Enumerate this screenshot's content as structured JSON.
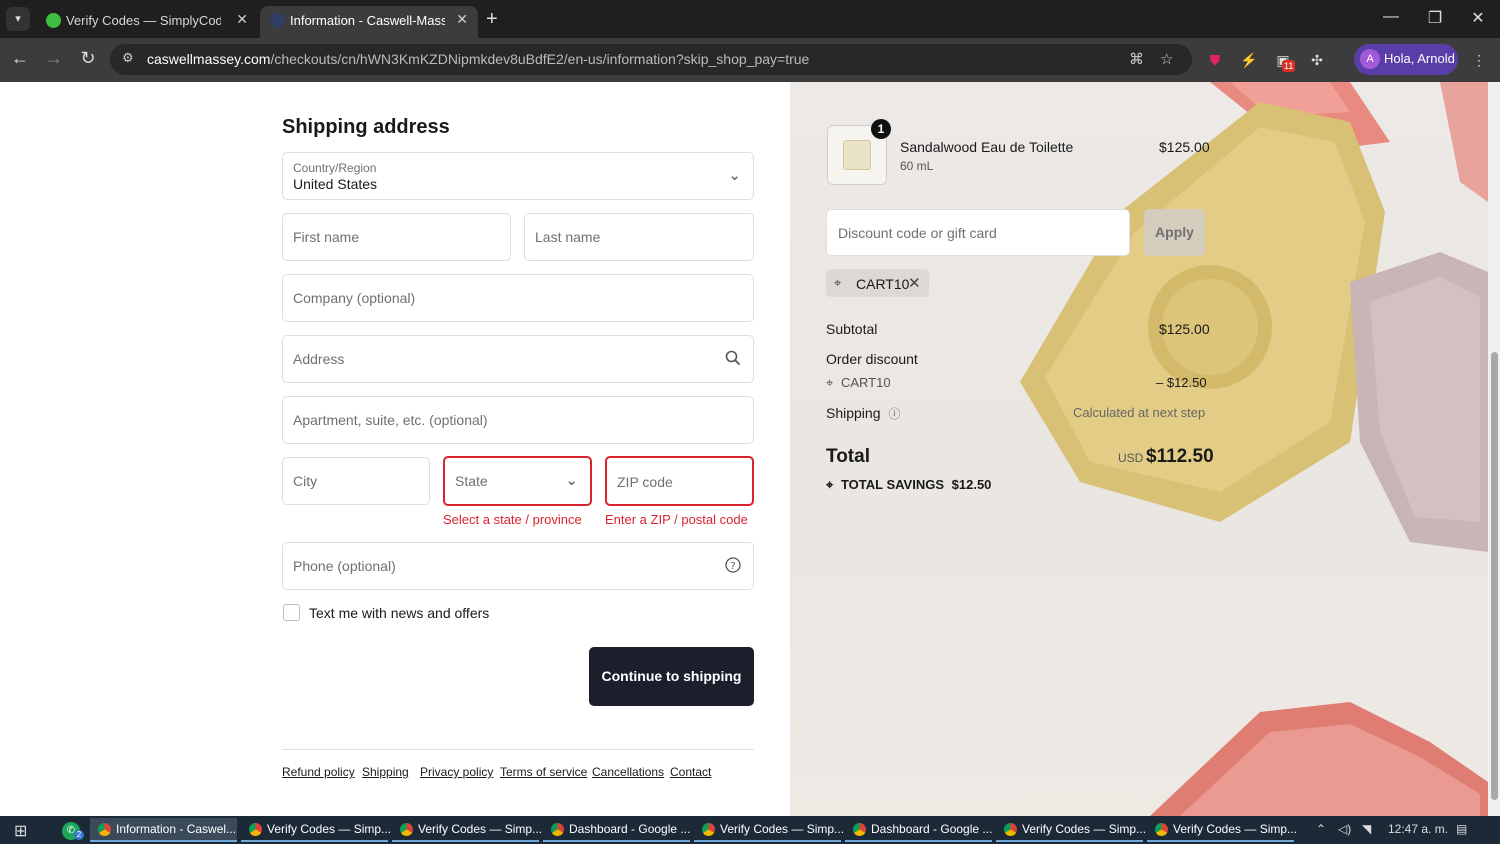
{
  "browser": {
    "tabs": [
      {
        "title": "Verify Codes — SimplyCodes",
        "active": false
      },
      {
        "title": "Information - Caswell-Massey®",
        "active": true
      }
    ],
    "url_domain": "caswellmassey.com",
    "url_path": "/checkouts/cn/hWN3KmKZDNipmkdev8uBdfE2/en-us/information?skip_shop_pay=true",
    "profile_name": "Hola, Arnold",
    "profile_initial": "A",
    "extension_badge": "11"
  },
  "form": {
    "section_title": "Shipping address",
    "country_label": "Country/Region",
    "country_value": "United States",
    "first_name_placeholder": "First name",
    "last_name_placeholder": "Last name",
    "company_placeholder": "Company (optional)",
    "address_placeholder": "Address",
    "apartment_placeholder": "Apartment, suite, etc. (optional)",
    "city_placeholder": "City",
    "state_placeholder": "State",
    "zip_placeholder": "ZIP code",
    "state_error": "Select a state / province",
    "zip_error": "Enter a ZIP / postal code",
    "phone_placeholder": "Phone (optional)",
    "sms_opt_in_label": "Text me with news and offers",
    "continue_button": "Continue to shipping"
  },
  "footer_links": [
    "Refund policy",
    "Shipping",
    "Privacy policy",
    "Terms of service",
    "Cancellations",
    "Contact"
  ],
  "summary": {
    "item": {
      "name": "Sandalwood Eau de Toilette",
      "variant": "60 mL",
      "price": "$125.00",
      "quantity": "1"
    },
    "discount_placeholder": "Discount code or gift card",
    "apply_button": "Apply",
    "applied_code": "CART10",
    "subtotal_label": "Subtotal",
    "subtotal_value": "$125.00",
    "order_discount_label": "Order discount",
    "order_discount_code": "CART10",
    "order_discount_value": "– $12.50",
    "shipping_label": "Shipping",
    "shipping_value": "Calculated at next step",
    "total_label": "Total",
    "total_currency": "USD",
    "total_value": "$112.50",
    "savings_label": "TOTAL SAVINGS",
    "savings_value": "$12.50"
  },
  "taskbar": {
    "items": [
      {
        "label": "Information - Caswel...",
        "active": true
      },
      {
        "label": "Verify Codes — Simp...",
        "active": false
      },
      {
        "label": "Verify Codes — Simp...",
        "active": false
      },
      {
        "label": "Dashboard - Google ...",
        "active": false
      },
      {
        "label": "Verify Codes — Simp...",
        "active": false
      },
      {
        "label": "Dashboard - Google ...",
        "active": false
      },
      {
        "label": "Verify Codes — Simp...",
        "active": false
      },
      {
        "label": "Verify Codes — Simp...",
        "active": false
      }
    ],
    "whatsapp_badge": "2",
    "time": "12:47 a. m."
  },
  "colors": {
    "error": "#d9232e",
    "primary_button": "#1a1f2b",
    "summary_bg": "#ece9e6"
  }
}
